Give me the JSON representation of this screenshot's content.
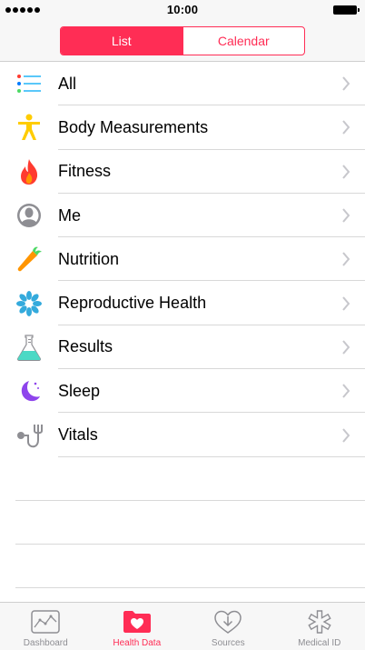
{
  "status_bar": {
    "time": "10:00"
  },
  "header": {
    "segments": [
      {
        "label": "List",
        "active": true
      },
      {
        "label": "Calendar",
        "active": false
      }
    ],
    "accent_color": "#ff2d55"
  },
  "categories": [
    {
      "label": "All",
      "icon": "list-icon"
    },
    {
      "label": "Body Measurements",
      "icon": "body-figure-icon"
    },
    {
      "label": "Fitness",
      "icon": "flame-icon"
    },
    {
      "label": "Me",
      "icon": "person-icon"
    },
    {
      "label": "Nutrition",
      "icon": "carrot-icon"
    },
    {
      "label": "Reproductive Health",
      "icon": "snowflake-flower-icon"
    },
    {
      "label": "Results",
      "icon": "flask-icon"
    },
    {
      "label": "Sleep",
      "icon": "moon-icon"
    },
    {
      "label": "Vitals",
      "icon": "stethoscope-icon"
    }
  ],
  "tabbar": {
    "tabs": [
      {
        "label": "Dashboard",
        "icon": "dashboard-icon",
        "active": false
      },
      {
        "label": "Health Data",
        "icon": "health-data-icon",
        "active": true
      },
      {
        "label": "Sources",
        "icon": "sources-icon",
        "active": false
      },
      {
        "label": "Medical ID",
        "icon": "medical-id-icon",
        "active": false
      }
    ]
  }
}
